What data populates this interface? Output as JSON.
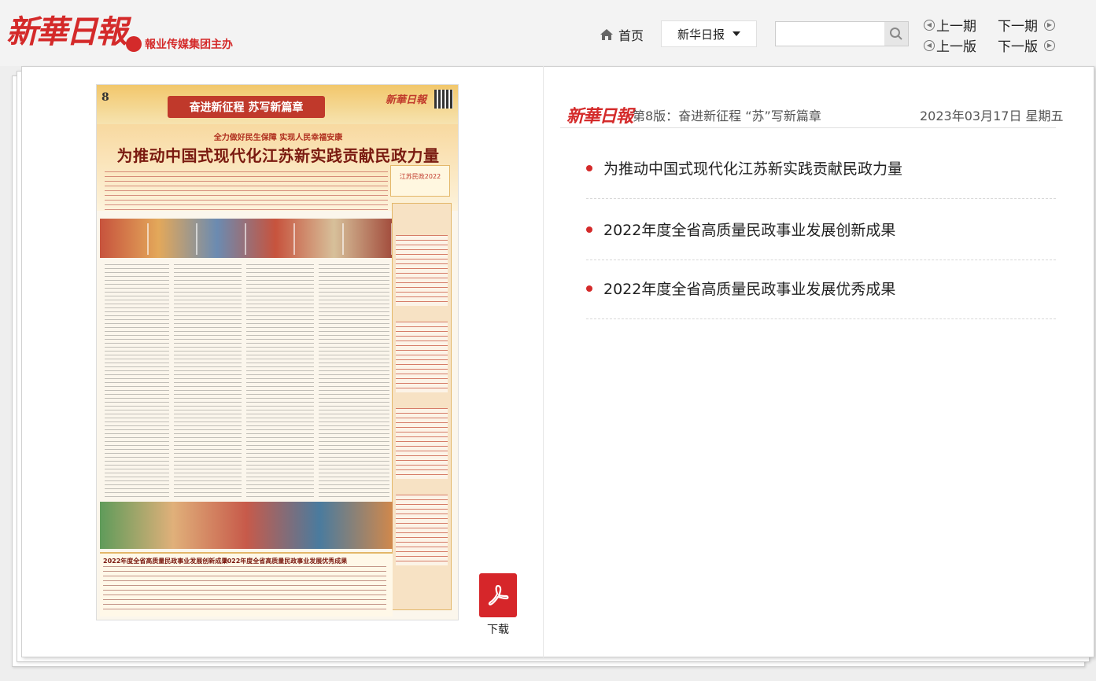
{
  "header": {
    "logo_text": "新華日報",
    "sub_text": "報业传媒集团主办",
    "home_label": "首页",
    "paper_select": "新华日报",
    "search_placeholder": "",
    "prev_issue": "上一期",
    "next_issue": "下一期",
    "prev_page": "上一版",
    "next_page": "下一版"
  },
  "newspaper": {
    "page_number": "8",
    "banner": "奋进新征程 苏写新篇章",
    "masthead": "新華日報",
    "subtitle": "全力做好民生保障 实现人民幸福安康",
    "headline": "为推动中国式现代化江苏新实践贡献民政力量",
    "side_badge": "江苏民政2022",
    "bottom_title_1": "2022年度全省高质量民政事业发展创新成果",
    "bottom_title_2": "2022年度全省高质量民政事业发展优秀成果"
  },
  "download": {
    "label": "下载"
  },
  "panel": {
    "logo_text": "新華日報",
    "page_info": "第8版：奋进新征程 “苏”写新篇章",
    "date": "2023年03月17日 星期五",
    "articles": [
      "为推动中国式现代化江苏新实践贡献民政力量",
      "2022年度全省高质量民政事业发展创新成果",
      "2022年度全省高质量民政事业发展优秀成果"
    ]
  },
  "colors": {
    "brand_red": "#d42a2a"
  }
}
